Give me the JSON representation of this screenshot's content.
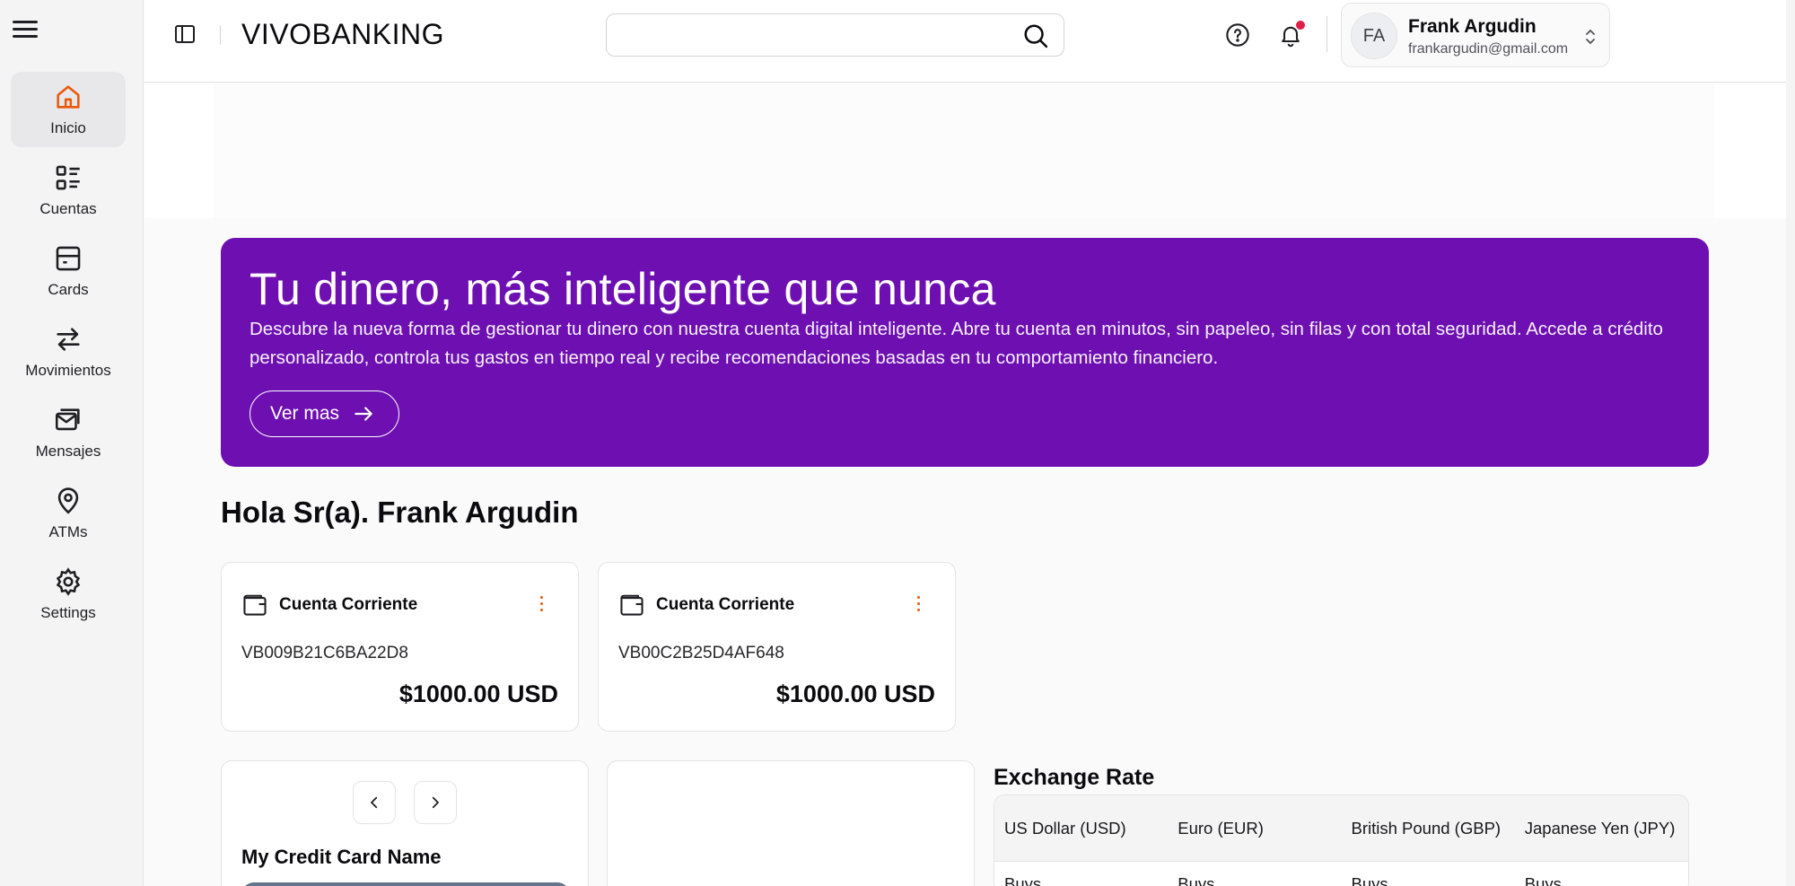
{
  "app": {
    "brand": "VIVOBANKING"
  },
  "sidebar": {
    "items": [
      {
        "label": "Inicio",
        "icon": "home-icon",
        "active": true
      },
      {
        "label": "Cuentas",
        "icon": "list-icon"
      },
      {
        "label": "Cards",
        "icon": "card-icon"
      },
      {
        "label": "Movimientos",
        "icon": "arrows-icon"
      },
      {
        "label": "Mensajes",
        "icon": "mail-icon"
      },
      {
        "label": "ATMs",
        "icon": "map-pin-icon"
      },
      {
        "label": "Settings",
        "icon": "gear-icon"
      }
    ]
  },
  "header": {
    "search": {
      "value": "",
      "placeholder": ""
    },
    "user": {
      "initials": "FA",
      "name": "Frank Argudin",
      "email": "frankargudin@gmail.com"
    }
  },
  "banner": {
    "title": "Tu dinero, más inteligente que nunca",
    "text": "Descubre la nueva forma de gestionar tu dinero con nuestra cuenta digital inteligente. Abre tu cuenta en minutos, sin papeleo, sin filas y con total seguridad. Accede a crédito personalizado, controla tus gastos en tiempo real y recibe recomendaciones basadas en tu comportamiento financiero.",
    "button": "Ver mas"
  },
  "greeting": "Hola Sr(a). Frank Argudin",
  "accounts": [
    {
      "type": "Cuenta Corriente",
      "number": "VB009B21C6BA22D8",
      "balance": "$1000.00 USD"
    },
    {
      "type": "Cuenta Corriente",
      "number": "VB00C2B25D4AF648",
      "balance": "$1000.00 USD"
    }
  ],
  "credit_card": {
    "name": "My Credit Card Name"
  },
  "exchange": {
    "title": "Exchange Rate",
    "columns": [
      "US Dollar (USD)",
      "Euro (EUR)",
      "British Pound (GBP)",
      "Japanese Yen (JPY)"
    ],
    "row": [
      "Buys",
      "Buys",
      "Buys",
      "Buys"
    ]
  },
  "colors": {
    "accent": "#ea580c",
    "banner": "#6e10b1",
    "notification_dot": "#e11d48"
  }
}
